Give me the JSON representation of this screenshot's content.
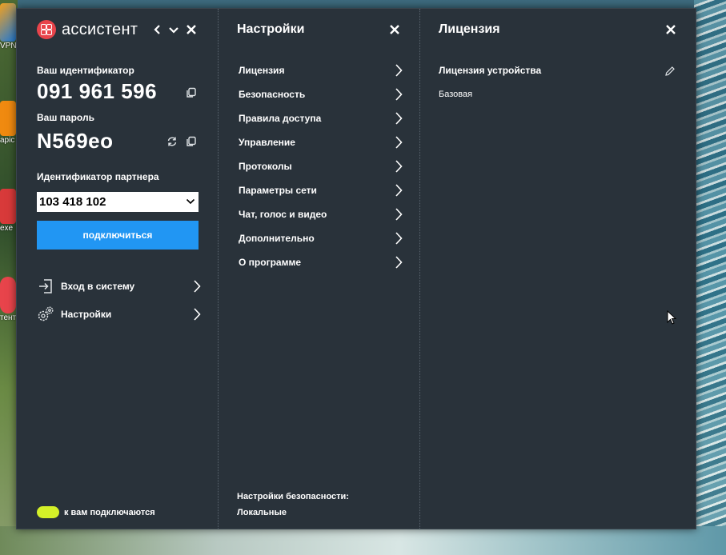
{
  "desktop": {
    "icon_labels": [
      "VPN",
      "apic",
      "exe",
      "тент"
    ]
  },
  "app": {
    "brand_name": "ассистент",
    "brand_color": "#e8444b",
    "accent_color": "#2196f3",
    "status_color": "#d4f028"
  },
  "main_panel": {
    "id_label": "Ваш идентификатор",
    "id_value": "091 961 596",
    "password_label": "Ваш пароль",
    "password_value": "N569eo",
    "partner_label": "Идентификатор партнера",
    "partner_value": "103 418 102",
    "connect_label": "подключиться",
    "nav": [
      {
        "label": "Вход в систему",
        "icon": "login-icon"
      },
      {
        "label": "Настройки",
        "icon": "gears-icon"
      }
    ],
    "status_text": "к вам подключаются"
  },
  "settings_panel": {
    "title": "Настройки",
    "items": [
      {
        "label": "Лицензия"
      },
      {
        "label": "Безопасность"
      },
      {
        "label": "Правила доступа"
      },
      {
        "label": "Управление"
      },
      {
        "label": "Протоколы"
      },
      {
        "label": "Параметры сети"
      },
      {
        "label": "Чат, голос и видео"
      },
      {
        "label": "Дополнительно"
      },
      {
        "label": "О программе"
      }
    ],
    "security_label": "Настройки безопасности:",
    "security_value": "Локальные"
  },
  "license_panel": {
    "title": "Лицензия",
    "device_license_label": "Лицензия устройства",
    "license_value": "Базовая"
  }
}
